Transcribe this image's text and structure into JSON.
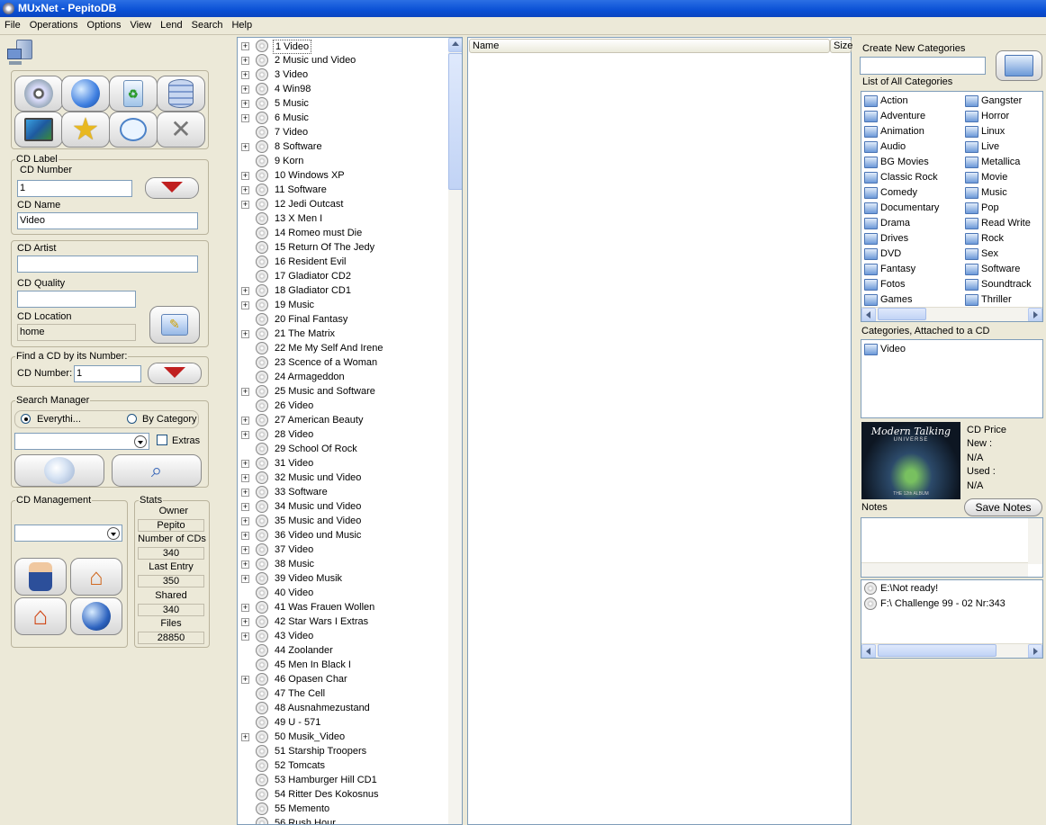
{
  "window": {
    "title": "MUxNet - PepitoDB"
  },
  "menu": [
    "File",
    "Operations",
    "Options",
    "View",
    "Lend",
    "Search",
    "Help"
  ],
  "cd_label": {
    "group": "CD Label",
    "number_label": "CD Number",
    "number_value": "1",
    "name_label": "CD Name",
    "name_value": "Video"
  },
  "cd_info": {
    "artist_label": "CD Artist",
    "artist_value": "",
    "quality_label": "CD Quality",
    "quality_value": "",
    "location_label": "CD Location",
    "location_value": "home"
  },
  "find": {
    "group": "Find a CD by its Number:",
    "label": "CD Number:",
    "value": "1"
  },
  "search_manager": {
    "group": "Search Manager",
    "opt_everything": "Everythi...",
    "opt_category": "By Category",
    "extras": "Extras"
  },
  "cd_management": {
    "group": "CD Management"
  },
  "stats": {
    "group": "Stats",
    "owner_label": "Owner",
    "owner": "Pepito",
    "num_cds_label": "Number of CDs",
    "num_cds": "340",
    "last_entry_label": "Last Entry",
    "last_entry": "350",
    "shared_label": "Shared",
    "shared": "340",
    "files_label": "Files",
    "files": "28850"
  },
  "tree_items": [
    {
      "label": "1 Video",
      "expand": true
    },
    {
      "label": "2 Music und Video",
      "expand": true
    },
    {
      "label": "3 Video",
      "expand": true
    },
    {
      "label": "4 Win98",
      "expand": true
    },
    {
      "label": "5 Music",
      "expand": true
    },
    {
      "label": "6 Music",
      "expand": true
    },
    {
      "label": "7 Video",
      "expand": false
    },
    {
      "label": "8 Software",
      "expand": true
    },
    {
      "label": "9 Korn",
      "expand": false
    },
    {
      "label": "10 Windows XP",
      "expand": true
    },
    {
      "label": "11 Software",
      "expand": true
    },
    {
      "label": "12 Jedi Outcast",
      "expand": true
    },
    {
      "label": "13 X Men I",
      "expand": false
    },
    {
      "label": "14 Romeo must Die",
      "expand": false
    },
    {
      "label": "15 Return Of The Jedy",
      "expand": false
    },
    {
      "label": "16 Resident Evil",
      "expand": false
    },
    {
      "label": "17 Gladiator CD2",
      "expand": false
    },
    {
      "label": "18 Gladiator CD1",
      "expand": true
    },
    {
      "label": "19 Music",
      "expand": true
    },
    {
      "label": "20 Final Fantasy",
      "expand": false
    },
    {
      "label": "21 The Matrix",
      "expand": true
    },
    {
      "label": "22 Me My Self And Irene",
      "expand": false
    },
    {
      "label": "23 Scence of a Woman",
      "expand": false
    },
    {
      "label": "24 Armageddon",
      "expand": false
    },
    {
      "label": "25 Music and Software",
      "expand": true
    },
    {
      "label": "26 Video",
      "expand": false
    },
    {
      "label": "27 American Beauty",
      "expand": true
    },
    {
      "label": "28 Video",
      "expand": true
    },
    {
      "label": "29 School Of Rock",
      "expand": false
    },
    {
      "label": "31 Video",
      "expand": true
    },
    {
      "label": "32 Music und Video",
      "expand": true
    },
    {
      "label": "33 Software",
      "expand": true
    },
    {
      "label": "34 Music und Video",
      "expand": true
    },
    {
      "label": "35 Music and Video",
      "expand": true
    },
    {
      "label": "36 Video und Music",
      "expand": true
    },
    {
      "label": "37 Video",
      "expand": true
    },
    {
      "label": "38 Music",
      "expand": true
    },
    {
      "label": "39 Video Musik",
      "expand": true
    },
    {
      "label": "40 Video",
      "expand": false
    },
    {
      "label": "41 Was Frauen Wollen",
      "expand": true
    },
    {
      "label": "42 Star Wars I Extras",
      "expand": true
    },
    {
      "label": "43 Video",
      "expand": true
    },
    {
      "label": "44 Zoolander",
      "expand": false
    },
    {
      "label": "45 Men In Black I",
      "expand": false
    },
    {
      "label": "46 Opasen Char",
      "expand": true
    },
    {
      "label": "47 The Cell",
      "expand": false
    },
    {
      "label": "48 Ausnahmezustand",
      "expand": false
    },
    {
      "label": "49 U - 571",
      "expand": false
    },
    {
      "label": "50 Musik_Video",
      "expand": true
    },
    {
      "label": "51 Starship Troopers",
      "expand": false
    },
    {
      "label": "52 Tomcats",
      "expand": false
    },
    {
      "label": "53 Hamburger Hill CD1",
      "expand": false
    },
    {
      "label": "54 Ritter Des Kokosnus",
      "expand": false
    },
    {
      "label": "55 Memento",
      "expand": false
    },
    {
      "label": "56 Rush Hour",
      "expand": false
    }
  ],
  "file_list": {
    "col_name": "Name",
    "col_size": "Size"
  },
  "categories": {
    "create_label": "Create New Categories",
    "create_value": "",
    "all_label": "List of All Categories",
    "col1": [
      "Action",
      "Adventure",
      "Animation",
      "Audio",
      "BG Movies",
      "Classic Rock",
      "Comedy",
      "Documentary",
      "Drama",
      "Drives",
      "DVD",
      "Fantasy",
      "Fotos",
      "Games"
    ],
    "col2": [
      "Gangster",
      "Horror",
      "Linux",
      "Live",
      "Metallica",
      "Movie",
      "Music",
      "Pop",
      "Read Write",
      "Rock",
      "Sex",
      "Software",
      "Soundtrack",
      "Thriller"
    ],
    "attached_label": "Categories, Attached to a CD",
    "attached": [
      "Video"
    ]
  },
  "album_art": {
    "title": "Modern Talking",
    "subtitle": "UNIVERSE",
    "footer": "THE 12th ALBUM"
  },
  "price": {
    "label": "CD Price",
    "new_label": "New :",
    "new_value": "N/A",
    "used_label": "Used :",
    "used_value": "N/A"
  },
  "notes": {
    "label": "Notes",
    "save": "Save Notes",
    "value": ""
  },
  "drives": [
    "E:\\Not ready!",
    "F:\\ Challenge 99 - 02 Nr:343"
  ],
  "icons": {
    "toolbar": [
      "cd-icon",
      "globe-icon",
      "recycle-icon",
      "database-icon",
      "screen-icon",
      "star-icon",
      "chat-bubble-icon",
      "tools-icon"
    ],
    "management": [
      "user-icon",
      "home-add-icon",
      "home-icon",
      "globe-icon"
    ]
  },
  "colors": {
    "titlebar": "#0a50d5",
    "chrome": "#ece9d8",
    "border": "#7f9db9"
  }
}
